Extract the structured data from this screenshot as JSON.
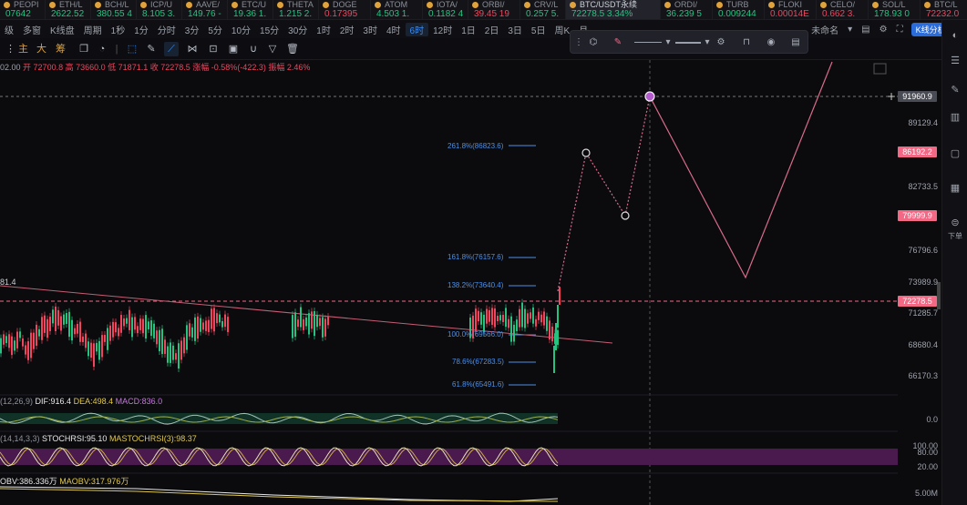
{
  "ticker": [
    {
      "name": "PEOPI",
      "price": "07642",
      "dir": "up"
    },
    {
      "name": "ETH/L",
      "price": "2622.52",
      "dir": "up"
    },
    {
      "name": "BCH/L",
      "price": "380.55 4",
      "dir": "up"
    },
    {
      "name": "ICP/U",
      "price": "8.105 3.",
      "dir": "up"
    },
    {
      "name": "AAVE/",
      "price": "149.76 -",
      "dir": "up"
    },
    {
      "name": "ETC/U",
      "price": "19.36 1.",
      "dir": "up"
    },
    {
      "name": "THETA",
      "price": "1.215 2.",
      "dir": "up"
    },
    {
      "name": "DOGE",
      "price": "0.17395",
      "dir": "dn"
    },
    {
      "name": "ATOM",
      "price": "4.503 1.",
      "dir": "up"
    },
    {
      "name": "IOTA/",
      "price": "0.1182 4",
      "dir": "up"
    },
    {
      "name": "ORBI/",
      "price": "39.45 19",
      "dir": "dn"
    },
    {
      "name": "CRV/L",
      "price": "0.257 5.",
      "dir": "up"
    }
  ],
  "ticker_main": {
    "name": "BTC/USDT永续",
    "price": "72278.5 3.34%"
  },
  "ticker_tail": [
    {
      "name": "ORDI/",
      "price": "36.239 5",
      "dir": "up"
    },
    {
      "name": "TURB",
      "price": "0.009244",
      "dir": "up"
    },
    {
      "name": "FLOKI",
      "price": "0.00014E",
      "dir": "dn"
    },
    {
      "name": "CELO/",
      "price": "0.662 3.",
      "dir": "dn"
    },
    {
      "name": "SOL/L",
      "price": "178.93 0",
      "dir": "up"
    },
    {
      "name": "BTC/L",
      "price": "72232.0",
      "dir": "dn"
    }
  ],
  "toolbar": {
    "left_items": [
      "级",
      "多窗",
      "K线盘",
      "周期",
      "1秒",
      "1分",
      "分时",
      "3分",
      "5分",
      "10分",
      "15分",
      "30分",
      "1时",
      "2时",
      "3时",
      "4时",
      "6时",
      "12时",
      "1日",
      "2日",
      "3日",
      "5日",
      "周K",
      "月"
    ],
    "selected": "6时",
    "unnamed": "未命名",
    "analysis_button": "K线分析"
  },
  "drawing_tools_text": {
    "main": "主",
    "big": "大",
    "chip": "筹"
  },
  "ohlc_line": {
    "open_label": "02.00",
    "high_val": "开 72700.8",
    "h": "高 73660.0",
    "l": "低 71871.1",
    "c": "收 72278.5",
    "change": "涨幅 -0.58%(-422.3)",
    "amp": "振幅 2.46%"
  },
  "axis": {
    "labels": [
      "89129.4",
      "82733.5",
      "76796.6",
      "73989.9",
      "71285.7",
      "68680.4",
      "66170.3"
    ],
    "crosshair_price": "91960.9",
    "tags": {
      "top": "86192.2",
      "bottom": "79999.9",
      "current": "72278.5"
    },
    "trend_start": "81.4"
  },
  "fib_levels": [
    {
      "label": "261.8%(86823.6)"
    },
    {
      "label": "161.8%(76157.6)"
    },
    {
      "label": "138.2%(73640.4)"
    },
    {
      "label": "100.0%(69566.0)"
    },
    {
      "label": "78.6%(67283.5)"
    },
    {
      "label": "61.8%(65491.6)"
    }
  ],
  "indicators": {
    "macd": {
      "prefix": "(12,26,9)",
      "dif": "DIF:916.4",
      "dea": "DEA:498.4",
      "macd": "MACD:836.0",
      "zero": "0.0"
    },
    "stoch": {
      "prefix": "(14,14,3,3)",
      "k": "STOCHRSI:95.10",
      "d": "MASTOCHRSI(3):98.37",
      "lv100": "100.00",
      "lv80": "80.00",
      "lv20": "20.00"
    },
    "obv": {
      "obv": "OBV:386.336万",
      "maobv": "MAOBV:317.976万",
      "lv": "5.00M"
    }
  },
  "sidebar": {
    "download_label": "下单"
  },
  "colors": {
    "up": "#26c281",
    "down": "#f0455e",
    "accent": "#3b8cf0",
    "fib": "#4d8fe6",
    "tag": "#f36884"
  }
}
